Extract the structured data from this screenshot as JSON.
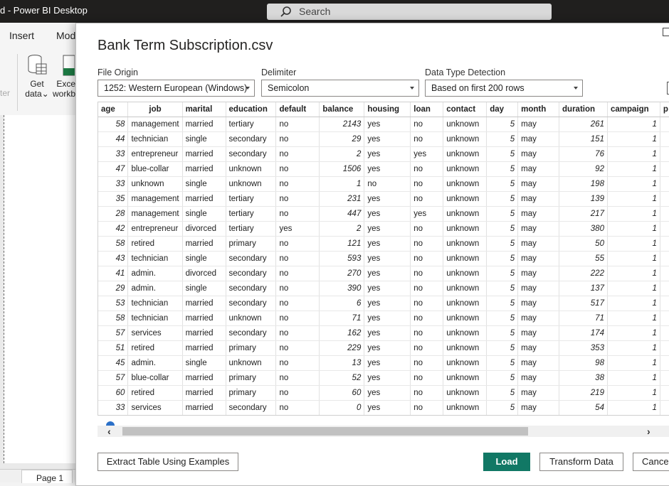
{
  "app": {
    "title": "d - Power BI Desktop",
    "search_placeholder": "Search",
    "tabs": [
      "Insert",
      "Mod"
    ],
    "ribbon": {
      "get_data_label": "Get",
      "get_data_label2": "data",
      "excel_label": "Exce",
      "excel_label2": "workb",
      "partial_label": "ter"
    },
    "page_tab": "Page 1"
  },
  "dialog": {
    "title": "Bank Term Subscription.csv",
    "file_origin": {
      "label": "File Origin",
      "value": "1252: Western European (Windows)"
    },
    "delimiter": {
      "label": "Delimiter",
      "value": "Semicolon"
    },
    "detection": {
      "label": "Data Type Detection",
      "value": "Based on first 200 rows"
    },
    "buttons": {
      "extract": "Extract Table Using Examples",
      "load": "Load",
      "transform": "Transform Data",
      "cancel": "Cancel"
    }
  },
  "table": {
    "columns": [
      "age",
      "job",
      "marital",
      "education",
      "default",
      "balance",
      "housing",
      "loan",
      "contact",
      "day",
      "month",
      "duration",
      "campaign",
      "p"
    ],
    "rows": [
      [
        "58",
        "management",
        "married",
        "tertiary",
        "no",
        "2143",
        "yes",
        "no",
        "unknown",
        "5",
        "may",
        "261",
        "1"
      ],
      [
        "44",
        "technician",
        "single",
        "secondary",
        "no",
        "29",
        "yes",
        "no",
        "unknown",
        "5",
        "may",
        "151",
        "1"
      ],
      [
        "33",
        "entrepreneur",
        "married",
        "secondary",
        "no",
        "2",
        "yes",
        "yes",
        "unknown",
        "5",
        "may",
        "76",
        "1"
      ],
      [
        "47",
        "blue-collar",
        "married",
        "unknown",
        "no",
        "1506",
        "yes",
        "no",
        "unknown",
        "5",
        "may",
        "92",
        "1"
      ],
      [
        "33",
        "unknown",
        "single",
        "unknown",
        "no",
        "1",
        "no",
        "no",
        "unknown",
        "5",
        "may",
        "198",
        "1"
      ],
      [
        "35",
        "management",
        "married",
        "tertiary",
        "no",
        "231",
        "yes",
        "no",
        "unknown",
        "5",
        "may",
        "139",
        "1"
      ],
      [
        "28",
        "management",
        "single",
        "tertiary",
        "no",
        "447",
        "yes",
        "yes",
        "unknown",
        "5",
        "may",
        "217",
        "1"
      ],
      [
        "42",
        "entrepreneur",
        "divorced",
        "tertiary",
        "yes",
        "2",
        "yes",
        "no",
        "unknown",
        "5",
        "may",
        "380",
        "1"
      ],
      [
        "58",
        "retired",
        "married",
        "primary",
        "no",
        "121",
        "yes",
        "no",
        "unknown",
        "5",
        "may",
        "50",
        "1"
      ],
      [
        "43",
        "technician",
        "single",
        "secondary",
        "no",
        "593",
        "yes",
        "no",
        "unknown",
        "5",
        "may",
        "55",
        "1"
      ],
      [
        "41",
        "admin.",
        "divorced",
        "secondary",
        "no",
        "270",
        "yes",
        "no",
        "unknown",
        "5",
        "may",
        "222",
        "1"
      ],
      [
        "29",
        "admin.",
        "single",
        "secondary",
        "no",
        "390",
        "yes",
        "no",
        "unknown",
        "5",
        "may",
        "137",
        "1"
      ],
      [
        "53",
        "technician",
        "married",
        "secondary",
        "no",
        "6",
        "yes",
        "no",
        "unknown",
        "5",
        "may",
        "517",
        "1"
      ],
      [
        "58",
        "technician",
        "married",
        "unknown",
        "no",
        "71",
        "yes",
        "no",
        "unknown",
        "5",
        "may",
        "71",
        "1"
      ],
      [
        "57",
        "services",
        "married",
        "secondary",
        "no",
        "162",
        "yes",
        "no",
        "unknown",
        "5",
        "may",
        "174",
        "1"
      ],
      [
        "51",
        "retired",
        "married",
        "primary",
        "no",
        "229",
        "yes",
        "no",
        "unknown",
        "5",
        "may",
        "353",
        "1"
      ],
      [
        "45",
        "admin.",
        "single",
        "unknown",
        "no",
        "13",
        "yes",
        "no",
        "unknown",
        "5",
        "may",
        "98",
        "1"
      ],
      [
        "57",
        "blue-collar",
        "married",
        "primary",
        "no",
        "52",
        "yes",
        "no",
        "unknown",
        "5",
        "may",
        "38",
        "1"
      ],
      [
        "60",
        "retired",
        "married",
        "primary",
        "no",
        "60",
        "yes",
        "no",
        "unknown",
        "5",
        "may",
        "219",
        "1"
      ],
      [
        "33",
        "services",
        "married",
        "secondary",
        "no",
        "0",
        "yes",
        "no",
        "unknown",
        "5",
        "may",
        "54",
        "1"
      ]
    ],
    "numeric_columns": [
      0,
      5,
      9,
      11,
      12
    ]
  },
  "colors": {
    "primary_button": "#117865",
    "titlebar": "#201f1e"
  }
}
